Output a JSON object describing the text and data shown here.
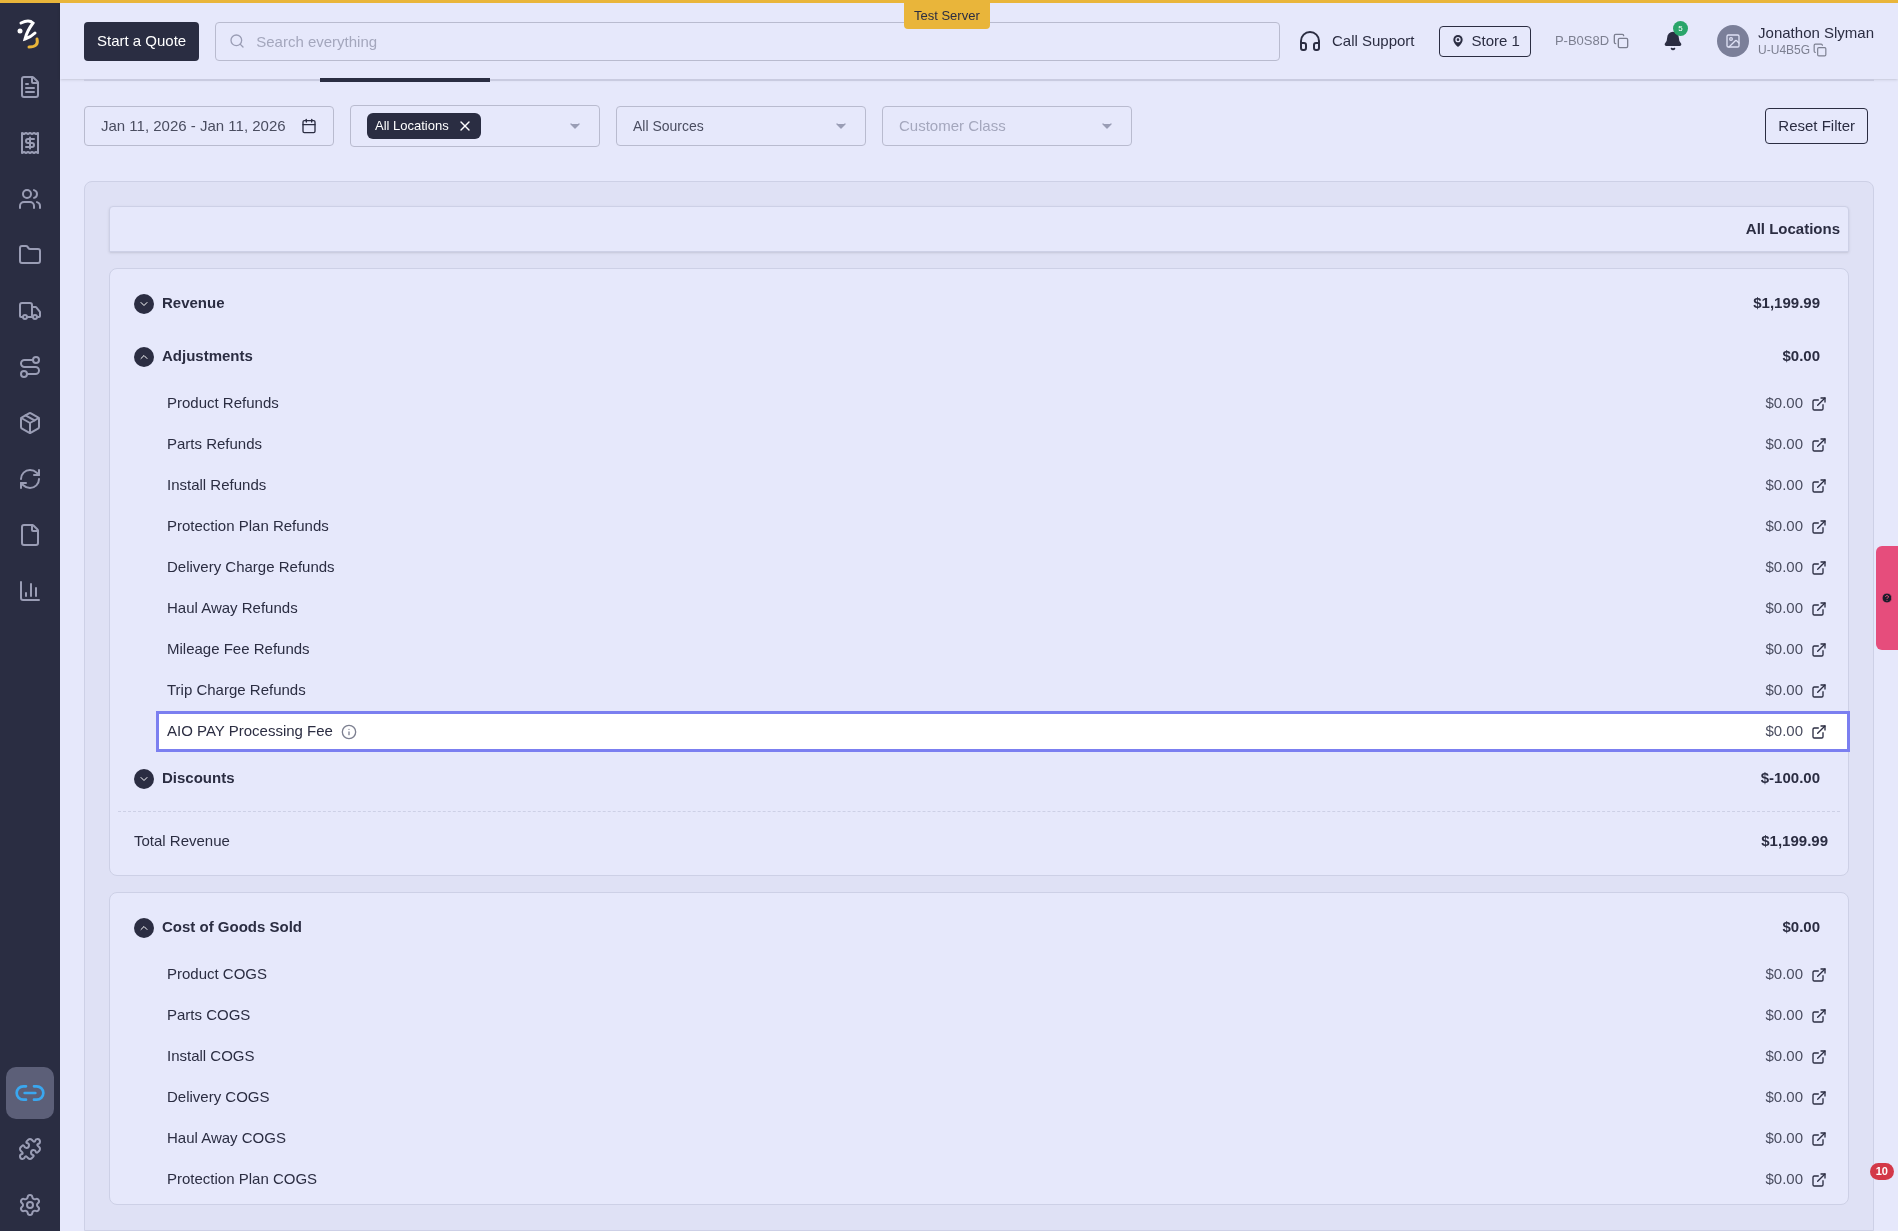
{
  "topbar": {
    "quote_button": "Start a Quote",
    "search": {
      "placeholder": "Search everything"
    },
    "server_badge": "Test Server",
    "support": "Call Support",
    "store": "Store 1",
    "phone_code": "P-B0S8D",
    "notifications": "5",
    "user": {
      "name": "Jonathon Slyman",
      "code": "U-U4B5G"
    }
  },
  "filters": {
    "date": "Jan 11, 2026 - Jan 11, 2026",
    "locations": {
      "chips": [
        "All Locations"
      ]
    },
    "sources": {
      "value": "All Sources"
    },
    "customer_class": {
      "placeholder": "Customer Class"
    },
    "reset": "Reset Filter"
  },
  "report": {
    "column_header": "All Locations",
    "sections": [
      {
        "groups": [
          {
            "label": "Revenue",
            "amount": "$1,199.99",
            "expanded": false
          },
          {
            "label": "Adjustments",
            "amount": "$0.00",
            "expanded": true,
            "children": [
              {
                "label": "Product Refunds",
                "amount": "$0.00",
                "info": false,
                "selected": false
              },
              {
                "label": "Parts Refunds",
                "amount": "$0.00",
                "info": false,
                "selected": false
              },
              {
                "label": "Install Refunds",
                "amount": "$0.00",
                "info": false,
                "selected": false
              },
              {
                "label": "Protection Plan Refunds",
                "amount": "$0.00",
                "info": false,
                "selected": false
              },
              {
                "label": "Delivery Charge Refunds",
                "amount": "$0.00",
                "info": false,
                "selected": false
              },
              {
                "label": "Haul Away Refunds",
                "amount": "$0.00",
                "info": false,
                "selected": false
              },
              {
                "label": "Mileage Fee Refunds",
                "amount": "$0.00",
                "info": false,
                "selected": false
              },
              {
                "label": "Trip Charge Refunds",
                "amount": "$0.00",
                "info": false,
                "selected": false
              },
              {
                "label": "AIO PAY Processing Fee",
                "amount": "$0.00",
                "info": true,
                "selected": true
              }
            ]
          },
          {
            "label": "Discounts",
            "amount": "$-100.00",
            "expanded": false
          }
        ],
        "total": {
          "label": "Total Revenue",
          "amount": "$1,199.99"
        }
      },
      {
        "groups": [
          {
            "label": "Cost of Goods Sold",
            "amount": "$0.00",
            "expanded": true,
            "children": [
              {
                "label": "Product COGS",
                "amount": "$0.00",
                "info": false,
                "selected": false
              },
              {
                "label": "Parts COGS",
                "amount": "$0.00",
                "info": false,
                "selected": false
              },
              {
                "label": "Install COGS",
                "amount": "$0.00",
                "info": false,
                "selected": false
              },
              {
                "label": "Delivery COGS",
                "amount": "$0.00",
                "info": false,
                "selected": false
              },
              {
                "label": "Haul Away COGS",
                "amount": "$0.00",
                "info": false,
                "selected": false
              },
              {
                "label": "Protection Plan COGS",
                "amount": "$0.00",
                "info": false,
                "selected": false
              }
            ]
          }
        ]
      }
    ]
  },
  "floating_badge": "10"
}
